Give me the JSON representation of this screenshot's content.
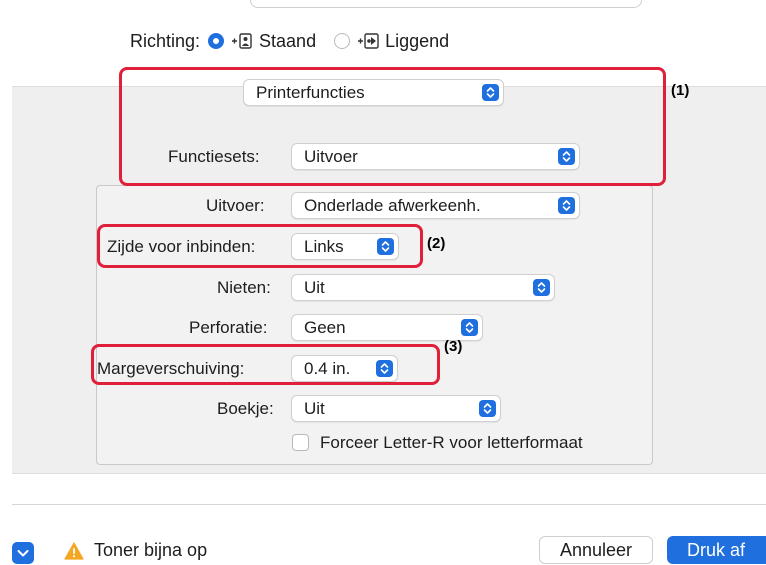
{
  "orientation": {
    "label": "Richting:",
    "options": [
      "Staand",
      "Liggend"
    ],
    "selected": "Staand"
  },
  "panel_menu": {
    "value": "Printerfuncties"
  },
  "feature_sets": {
    "label": "Functiesets:",
    "value": "Uitvoer"
  },
  "fields": {
    "output": {
      "label": "Uitvoer:",
      "value": "Onderlade afwerkeenh."
    },
    "binding_edge": {
      "label": "Zijde voor inbinden:",
      "value": "Links"
    },
    "staple": {
      "label": "Nieten:",
      "value": "Uit"
    },
    "punch": {
      "label": "Perforatie:",
      "value": "Geen"
    },
    "margin_shift": {
      "label": "Margeverschuiving:",
      "value": "0.4 in."
    },
    "booklet": {
      "label": "Boekje:",
      "value": "Uit"
    }
  },
  "checkbox": {
    "label": "Forceer Letter-R voor letterformaat",
    "checked": false
  },
  "annotations": [
    "(1)",
    "(2)",
    "(3)"
  ],
  "status": {
    "text": "Toner bijna op",
    "icon": "warning-icon"
  },
  "buttons": {
    "cancel": "Annuleer",
    "print": "Druk af"
  },
  "colors": {
    "accent": "#1f6fdf",
    "annotation": "#e0203a",
    "warning": "#f5a623"
  }
}
